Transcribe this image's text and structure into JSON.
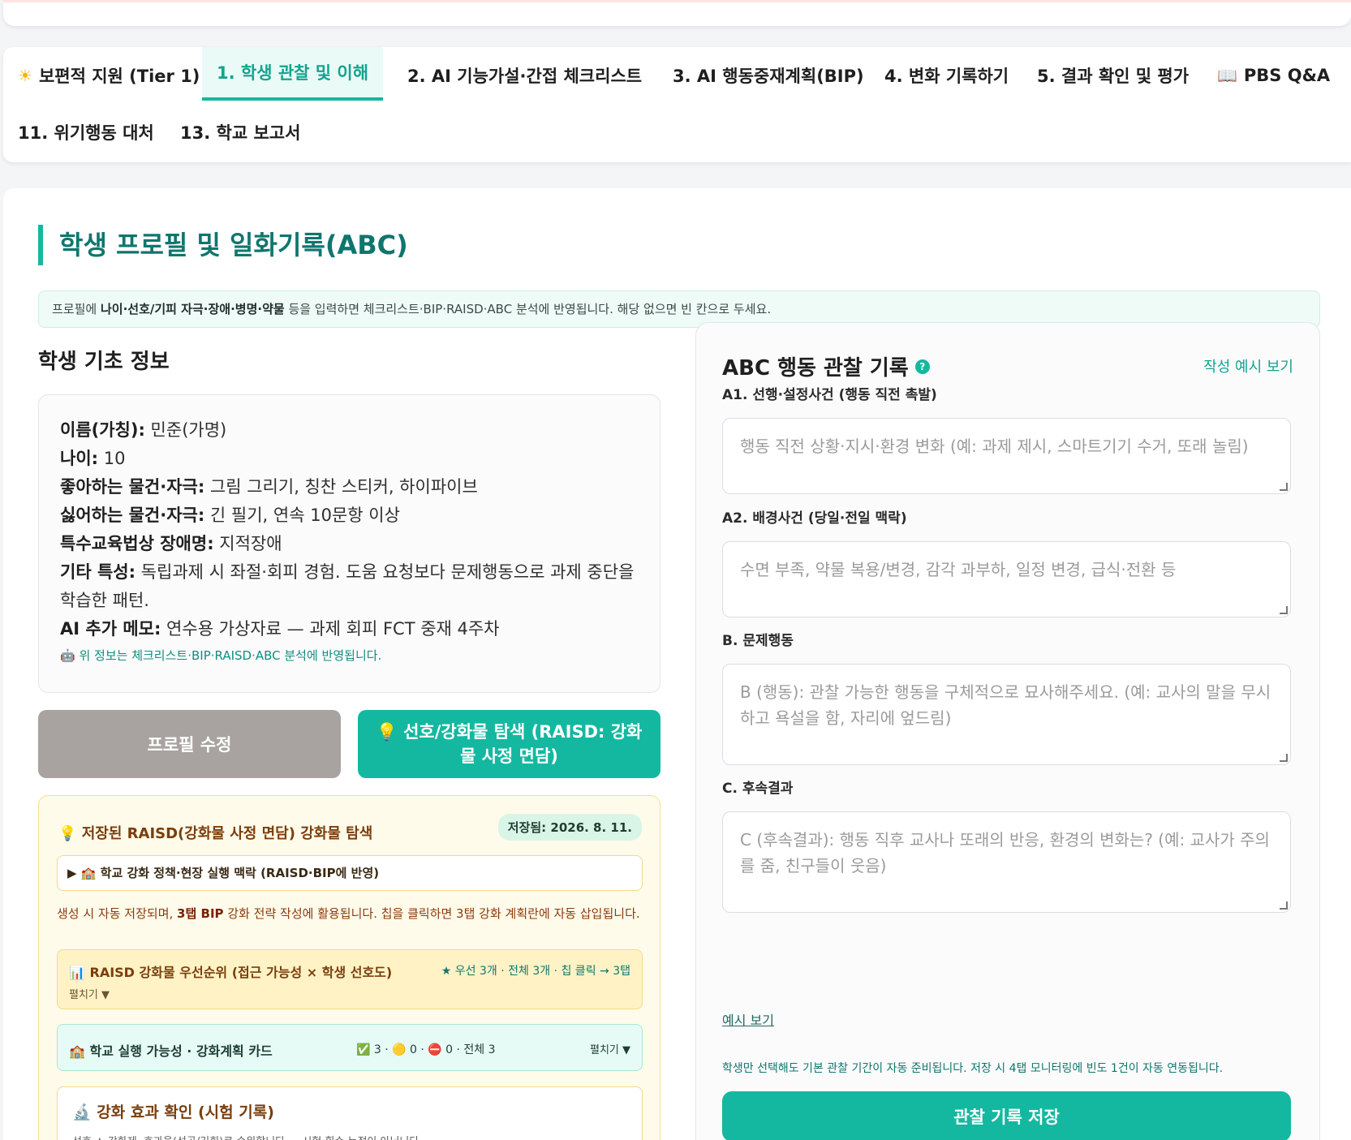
{
  "tabs": [
    {
      "icon": "☀",
      "label": "보편적 지원 (Tier 1)"
    },
    {
      "label": "1. 학생 관찰 및 이해"
    },
    {
      "label": "2. AI 기능가설·간접 체크리스트"
    },
    {
      "label": "3. AI 행동중재계획(BIP)"
    },
    {
      "label": "4. 변화 기록하기"
    },
    {
      "label": "5. 결과 확인 및 평가"
    },
    {
      "icon": "📖",
      "label": "PBS Q&A"
    },
    {
      "label": "11. 위기행동 대처"
    },
    {
      "label": "13. 학교 보고서"
    }
  ],
  "page": {
    "title": "학생 프로필 및 일화기록(ABC)",
    "notice_prefix": "프로필에 ",
    "notice_bold": "나이·선호/기피 자극·장애·병명·약물",
    "notice_suffix": " 등을 입력하면 체크리스트·BIP·RAISD·ABC 분석에 반영됩니다. 해당 없으면 빈 칸으로 두세요."
  },
  "profile": {
    "heading": "학생 기초 정보",
    "fields": [
      {
        "label": "이름(가칭):",
        "value": " 민준(가명)"
      },
      {
        "label": "나이:",
        "value": " 10"
      },
      {
        "label": "좋아하는 물건·자극:",
        "value": " 그림 그리기, 칭찬 스티커, 하이파이브"
      },
      {
        "label": "싫어하는 물건·자극:",
        "value": " 긴 필기, 연속 10문항 이상"
      },
      {
        "label": "특수교육법상 장애명:",
        "value": " 지적장애"
      },
      {
        "label": "기타 특성:",
        "value": " 독립과제 시 좌절·회피 경험. 도움 요청보다 문제행동으로 과제 중단을 학습한 패턴."
      },
      {
        "label": "AI 추가 메모:",
        "value": " 연수용 가상자료 — 과제 회피 FCT 중재 4주차"
      }
    ],
    "note_icon": "🤖",
    "note": "위 정보는 체크리스트·BIP·RAISD·ABC 분석에 반영됩니다.",
    "edit_button": "프로필 수정",
    "raisd_button_icon": "💡",
    "raisd_button": "선호/강화물 탐색 (RAISD: 강화물 사정 면담)"
  },
  "raisd": {
    "title_icon": "💡",
    "title": "저장된 RAISD(강화물 사정 면담) 강화물 탐색",
    "saved_badge": "저장됨: 2026. 8. 11.",
    "context_toggle": "▶ 🏫 학교 강화 정책·현장 실행 맥락 (RAISD·BIP에 반영)",
    "desc_1": "생성 시 자동 저장되며, ",
    "desc_bold": "3탭 BIP",
    "desc_2": " 강화 전략 작성에 활용됩니다. 칩을 클릭하면 3탭 강화 계획란에 자동 삽입됩니다.",
    "priority_title": "📊 RAISD 강화물 우선순위 (접근 가능성 × 학생 선호도)",
    "priority_meta": "★ 우선 3개 · 전체 3개 · 칩 클릭 → 3탭",
    "priority_toggle": "펼치기 ▼",
    "school_title": "🏫 학교 실행 가능성 · 강화계획 카드",
    "school_stats": "✅ 3 · 🟡 0 · ⛔ 0 · 전체 3",
    "school_toggle": "펼치기 ▼",
    "effect_title": "🔬 강화 효과 확인 (시험 기록)",
    "effect_sub": "선호 ★ 강화제, 효과율(성공/기회)로 순위합니다 — 시험 횟수 누적이 아닙니다"
  },
  "abc": {
    "title": "ABC 행동 관찰 기록",
    "help": "?",
    "example_link": "작성 예시 보기",
    "fields": [
      {
        "label": "A1. 선행·설정사건 (행동 직전 촉발)",
        "placeholder": "행동 직전 상황·지시·환경 변화 (예: 과제 제시, 스마트기기 수거, 또래 놀림)"
      },
      {
        "label": "A2. 배경사건 (당일·전일 맥락)",
        "placeholder": "수면 부족, 약물 복용/변경, 감각 과부하, 일정 변경, 급식·전환 등"
      },
      {
        "label": "B. 문제행동",
        "placeholder": "B (행동): 관찰 가능한 행동을 구체적으로 묘사해주세요. (예: 교사의 말을 무시하고 욕설을 함, 자리에 엎드림)"
      },
      {
        "label": "C. 후속결과",
        "placeholder": "C (후속결과): 행동 직후 교사나 또래의 반응, 환경의 변화는? (예: 교사가 주의를 줌, 친구들이 웃음)"
      }
    ],
    "example_small": "예시 보기",
    "auto_note": "학생만 선택해도 기본 관찰 기간이 자동 준비됩니다. 저장 시 4탭 모니터링에 빈도 1건이 자동 연동됩니다.",
    "save_button": "관찰 기록 저장"
  }
}
